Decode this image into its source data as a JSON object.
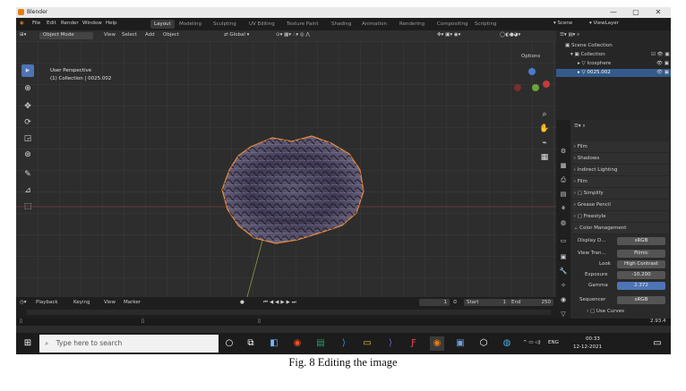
{
  "window": {
    "title": "Blender",
    "minimize": "—",
    "maximize": "▢",
    "close": "✕"
  },
  "topbar": {
    "menus": [
      "File",
      "Edit",
      "Render",
      "Window",
      "Help"
    ],
    "workspaces": [
      "Layout",
      "Modeling",
      "Sculpting",
      "UV Editing",
      "Texture Paint",
      "Shading",
      "Animation",
      "Rendering",
      "Compositing",
      "Scripting"
    ],
    "active_workspace": "Layout",
    "scene_label": "Scene",
    "view_layer_label": "ViewLayer"
  },
  "viewport_header": {
    "mode": "Object Mode",
    "menus": [
      "View",
      "Select",
      "Add",
      "Object"
    ],
    "transform": "Global",
    "options": "Options"
  },
  "viewport": {
    "perspective": "User Perspective",
    "collection": "(1) Collection | 0025.002"
  },
  "timeline": {
    "menus": [
      "Playback",
      "Keying",
      "View",
      "Marker"
    ],
    "current_frame": "1",
    "start_label": "Start",
    "start": "1",
    "end_label": "End",
    "end": "250"
  },
  "outliner": {
    "root": "Scene Collection",
    "collection": "Collection",
    "items": [
      "Icosphere",
      "0025.002"
    ],
    "selected": "0025.002"
  },
  "properties": {
    "sections": [
      "Film",
      "Shadows",
      "Indirect Lighting",
      "Film",
      "Simplify",
      "Grease Pencil",
      "Freestyle",
      "Color Management"
    ],
    "display_device_label": "Display D...",
    "display_device": "sRGB",
    "view_transform_label": "View Tran...",
    "view_transform": "Filmic",
    "look_label": "Look",
    "look": "High Contrast",
    "exposure_label": "Exposure",
    "exposure": "-10.200",
    "gamma_label": "Gamma",
    "gamma": "2.372",
    "sequencer_label": "Sequencer",
    "sequencer": "sRGB",
    "use_curves": "Use Curves",
    "version": "2.93.4"
  },
  "taskbar": {
    "search_placeholder": "Type here to search",
    "language": "ENG",
    "time": "00:33",
    "date": "12-12-2021"
  },
  "caption": "Fig. 8    Editing the image",
  "colors": {
    "accent": "#4d74b5",
    "object_outline": "#e88a3a",
    "selection": "#335a8a"
  }
}
